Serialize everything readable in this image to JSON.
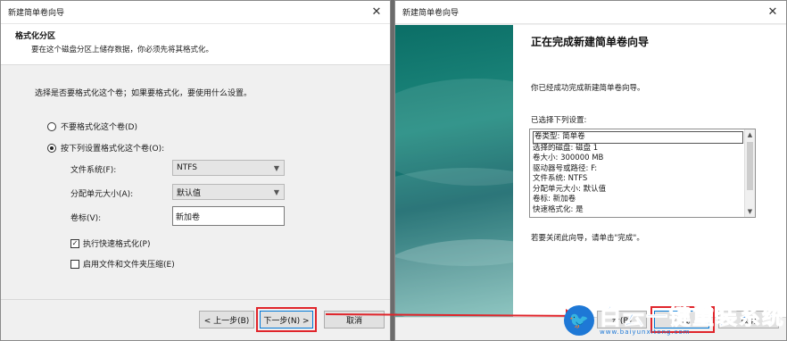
{
  "left_window": {
    "title": "新建简单卷向导",
    "close_glyph": "✕",
    "header": {
      "title": "格式化分区",
      "subtitle": "要在这个磁盘分区上储存数据，你必须先将其格式化。"
    },
    "prompt": "选择是否要格式化这个卷；如果要格式化，要使用什么设置。",
    "options": {
      "no_format": "不要格式化这个卷(D)",
      "format_with": "按下列设置格式化这个卷(O):"
    },
    "fields": {
      "filesystem_label": "文件系统(F):",
      "filesystem_value": "NTFS",
      "alloc_label": "分配单元大小(A):",
      "alloc_value": "默认值",
      "volume_label": "卷标(V):",
      "volume_value": "新加卷"
    },
    "checks": {
      "quick_format": "执行快速格式化(P)",
      "quick_format_checked": true,
      "compression": "启用文件和文件夹压缩(E)",
      "compression_checked": false
    },
    "buttons": {
      "back": "< 上一步(B)",
      "next": "下一步(N) >",
      "cancel": "取消"
    }
  },
  "right_window": {
    "title": "新建简单卷向导",
    "close_glyph": "✕",
    "heading": "正在完成新建简单卷向导",
    "success_text": "你已经成功完成新建简单卷向导。",
    "selected_label": "已选择下列设置:",
    "summary_lines": [
      "卷类型: 简单卷",
      "选择的磁盘: 磁盘 1",
      "卷大小: 300000 MB",
      "驱动器号或路径: F:",
      "文件系统: NTFS",
      "分配单元大小: 默认值",
      "卷标: 新加卷",
      "快速格式化: 是"
    ],
    "close_hint": "若要关闭此向导，请单击\"完成\"。",
    "buttons": {
      "back_partial": "步(B)",
      "finish": "完成",
      "cancel": "取消"
    }
  },
  "watermark": {
    "brand": "白云一键重装系统",
    "url": "www.baiyunxitong.com"
  },
  "colors": {
    "highlight": "#e0252b",
    "brand_blue": "#1e78d6",
    "teal": "#0b6e66"
  }
}
